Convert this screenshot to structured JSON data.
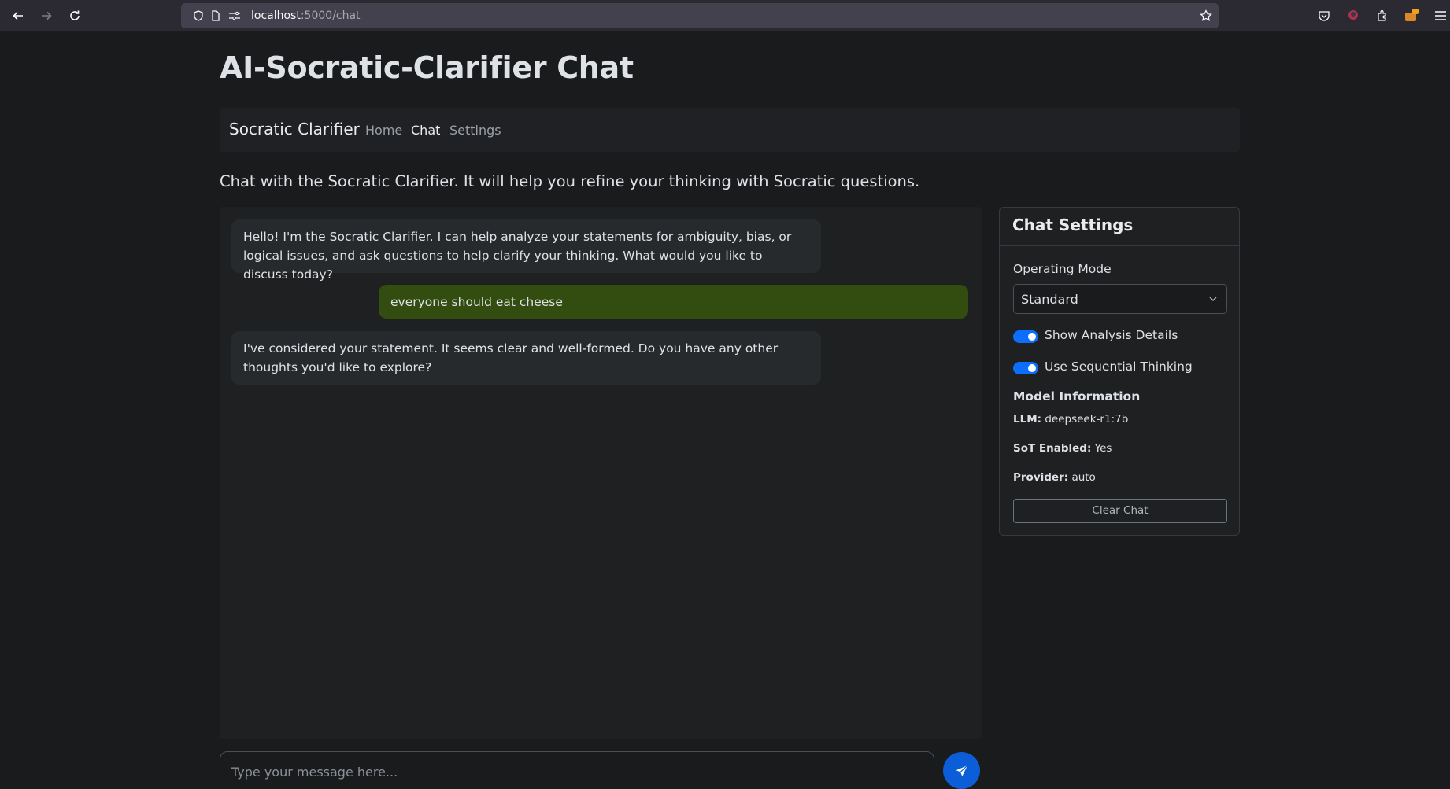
{
  "browser": {
    "url_host": "localhost",
    "url_path": ":5000/chat",
    "back_icon": "arrow-left-icon",
    "forward_icon": "arrow-right-icon",
    "reload_icon": "reload-icon"
  },
  "page": {
    "title": "AI-Socratic-Clarifier Chat",
    "intro": "Chat with the Socratic Clarifier. It will help you refine your thinking with Socratic questions."
  },
  "navbar": {
    "brand": "Socratic Clarifier",
    "links": [
      {
        "label": "Home",
        "active": false
      },
      {
        "label": "Chat",
        "active": true
      },
      {
        "label": "Settings",
        "active": false
      }
    ]
  },
  "chat": {
    "messages": [
      {
        "role": "bot",
        "text": "Hello! I'm the Socratic Clarifier. I can help analyze your statements for ambiguity, bias, or logical issues, and ask questions to help clarify your thinking. What would you like to discuss today?"
      },
      {
        "role": "user",
        "text": "everyone should eat cheese"
      },
      {
        "role": "bot",
        "text": "I've considered your statement. It seems clear and well-formed. Do you have any other thoughts you'd like to explore?"
      }
    ],
    "input_placeholder": "Type your message here...",
    "input_value": "",
    "send_icon": "paper-plane-icon"
  },
  "settings": {
    "title": "Chat Settings",
    "mode_label": "Operating Mode",
    "mode_value": "Standard",
    "toggles": [
      {
        "label": "Show Analysis Details",
        "on": true
      },
      {
        "label": "Use Sequential Thinking",
        "on": true
      }
    ],
    "model_info_title": "Model Information",
    "model_info": [
      {
        "key": "LLM:",
        "value": "deepseek-r1:7b"
      },
      {
        "key": "SoT Enabled:",
        "value": "Yes"
      },
      {
        "key": "Provider:",
        "value": "auto"
      }
    ],
    "clear_label": "Clear Chat"
  },
  "colors": {
    "accent": "#0d6efd",
    "user_bubble": "#334d10",
    "background": "#1a1b1d"
  }
}
